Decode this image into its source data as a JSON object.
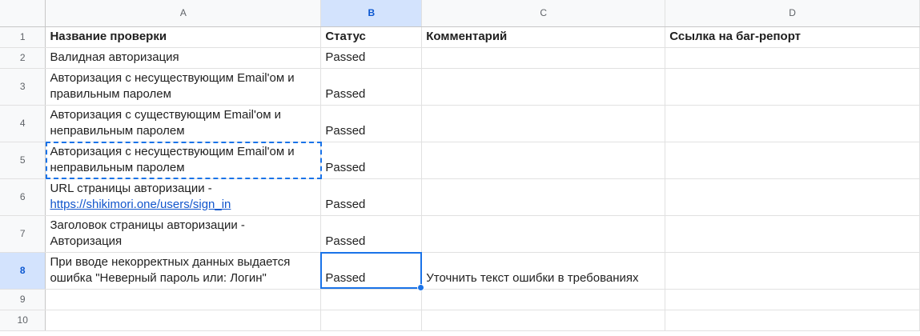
{
  "columns": [
    "A",
    "B",
    "C",
    "D"
  ],
  "selected_column": "B",
  "selected_row": "8",
  "rows": [
    {
      "num": "1",
      "a": "Название проверки",
      "b": "Статус",
      "c": "Комментарий",
      "d": "Ссылка на баг-репорт"
    },
    {
      "num": "2",
      "a": "Валидная авторизация",
      "b": "Passed",
      "c": "",
      "d": ""
    },
    {
      "num": "3",
      "a": "Авторизация с несуществующим Email'ом и правильным паролем",
      "b": "Passed",
      "c": "",
      "d": ""
    },
    {
      "num": "4",
      "a": "Авторизация с существующим Email'ом и неправильным паролем",
      "b": "Passed",
      "c": "",
      "d": ""
    },
    {
      "num": "5",
      "a": "Авторизация с несуществующим Email'ом и неправильным паролем",
      "b": "Passed",
      "c": "",
      "d": ""
    },
    {
      "num": "6",
      "a_text": "URL страницы авторизации -",
      "a_link": "https://shikimori.one/users/sign_in",
      "b": "Passed",
      "c": "",
      "d": ""
    },
    {
      "num": "7",
      "a": "Заголовок страницы авторизации - Авторизация",
      "b": "Passed",
      "c": "",
      "d": ""
    },
    {
      "num": "8",
      "a": "При вводе некорректных данных выдается ошибка \"Неверный пароль или: Логин\"",
      "b": "Passed",
      "c": "Уточнить текст ошибки в требованиях",
      "d": ""
    },
    {
      "num": "9",
      "a": "",
      "b": "",
      "c": "",
      "d": ""
    },
    {
      "num": "10",
      "a": "",
      "b": "",
      "c": "",
      "d": ""
    }
  ],
  "colors": {
    "selection": "#1a73e8",
    "header_selected": "#d3e3fd",
    "link": "#1155cc"
  }
}
